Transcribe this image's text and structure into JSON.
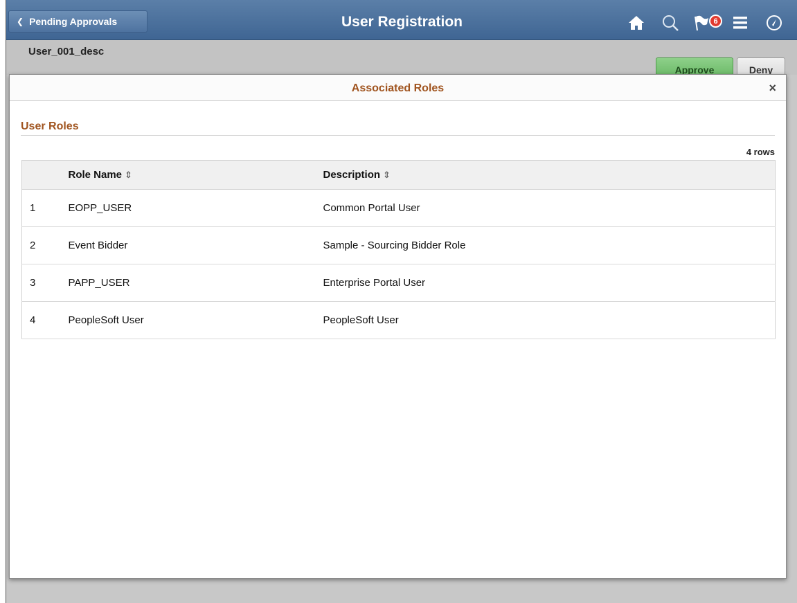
{
  "header": {
    "back_label": "Pending Approvals",
    "title": "User Registration",
    "notification_count": "6",
    "icons": [
      "home-icon",
      "search-icon",
      "flag-icon",
      "menu-icon",
      "nav-icon"
    ]
  },
  "subheader": {
    "user_desc": "User_001_desc",
    "approve_label": "Approve",
    "deny_label": "Deny"
  },
  "modal": {
    "title": "Associated Roles",
    "close_label": "×",
    "section_title": "User Roles",
    "row_count": "4 rows",
    "columns": {
      "role_name": "Role Name",
      "description": "Description"
    },
    "rows": [
      {
        "num": "1",
        "role": "EOPP_USER",
        "desc": "Common Portal User"
      },
      {
        "num": "2",
        "role": "Event Bidder",
        "desc": "Sample - Sourcing Bidder Role"
      },
      {
        "num": "3",
        "role": "PAPP_USER",
        "desc": "Enterprise Portal User"
      },
      {
        "num": "4",
        "role": "PeopleSoft User",
        "desc": "PeopleSoft User"
      }
    ]
  },
  "colors": {
    "header_bg": "#4a6f9c",
    "accent_title": "#a0541f",
    "approve_bg": "#74c070",
    "badge": "#e23a2e"
  }
}
